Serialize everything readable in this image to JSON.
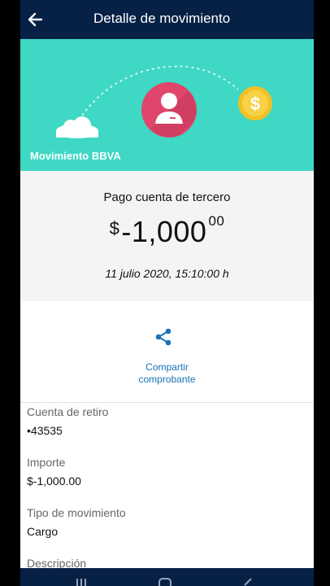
{
  "header": {
    "title": "Detalle de movimiento"
  },
  "hero": {
    "label": "Movimiento BBVA",
    "colors": {
      "bg": "#3fd8c4",
      "avatar": "#e0466b",
      "coin": "#f2c025"
    }
  },
  "summary": {
    "description": "Pago cuenta de tercero",
    "currency": "$",
    "amount_main": "-1,000",
    "amount_cents": "00",
    "date": "11 julio 2020, 15:10:00 h"
  },
  "share": {
    "line1": "Compartir",
    "line2": "comprobante"
  },
  "details": [
    {
      "label": "Cuenta de retiro",
      "value": "•43535"
    },
    {
      "label": "Importe",
      "value": "$-1,000.00"
    },
    {
      "label": "Tipo de movimiento",
      "value": "Cargo"
    },
    {
      "label": "Descripción",
      "value": ""
    }
  ],
  "icons": [
    "back-arrow-icon",
    "cloud-icon",
    "user-avatar-icon",
    "dollar-coin-icon",
    "share-icon",
    "recent-apps-icon",
    "home-icon",
    "back-nav-icon"
  ]
}
